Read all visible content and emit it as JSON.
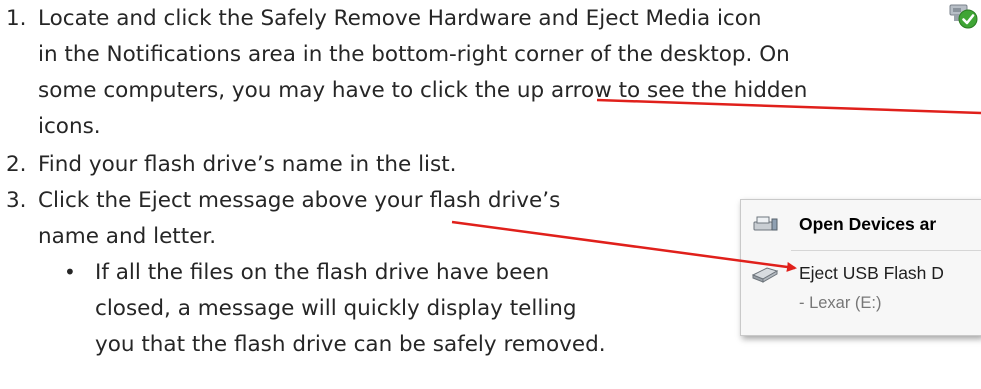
{
  "steps": [
    {
      "number": "1.",
      "lines": [
        "Locate and click the Safely Remove Hardware and Eject Media icon",
        "in the Notifications area in the bottom-right corner of the desktop. On",
        "some computers, you may have to click the up arrow to see the hidden",
        "icons."
      ]
    },
    {
      "number": "2.",
      "lines": [
        "Find your flash drive’s name in the list."
      ]
    },
    {
      "number": "3.",
      "lines": [
        "Click the Eject message above your flash drive’s",
        "name and letter."
      ]
    }
  ],
  "sub_bullet": {
    "symbol": "•",
    "lines": [
      "If all the files on the flash drive have been",
      "closed, a message will quickly display telling",
      "you that the flash drive can be safely removed."
    ]
  },
  "tray_icon": {
    "icon": "safely-remove-hardware-icon"
  },
  "popup": {
    "open_devices_label": "Open Devices ar",
    "eject_label": "Eject USB Flash D",
    "drive_label": "-   Lexar (E:)"
  },
  "colors": {
    "text": "#262626",
    "arrow": "#e0201b",
    "check": "#3fa535"
  }
}
